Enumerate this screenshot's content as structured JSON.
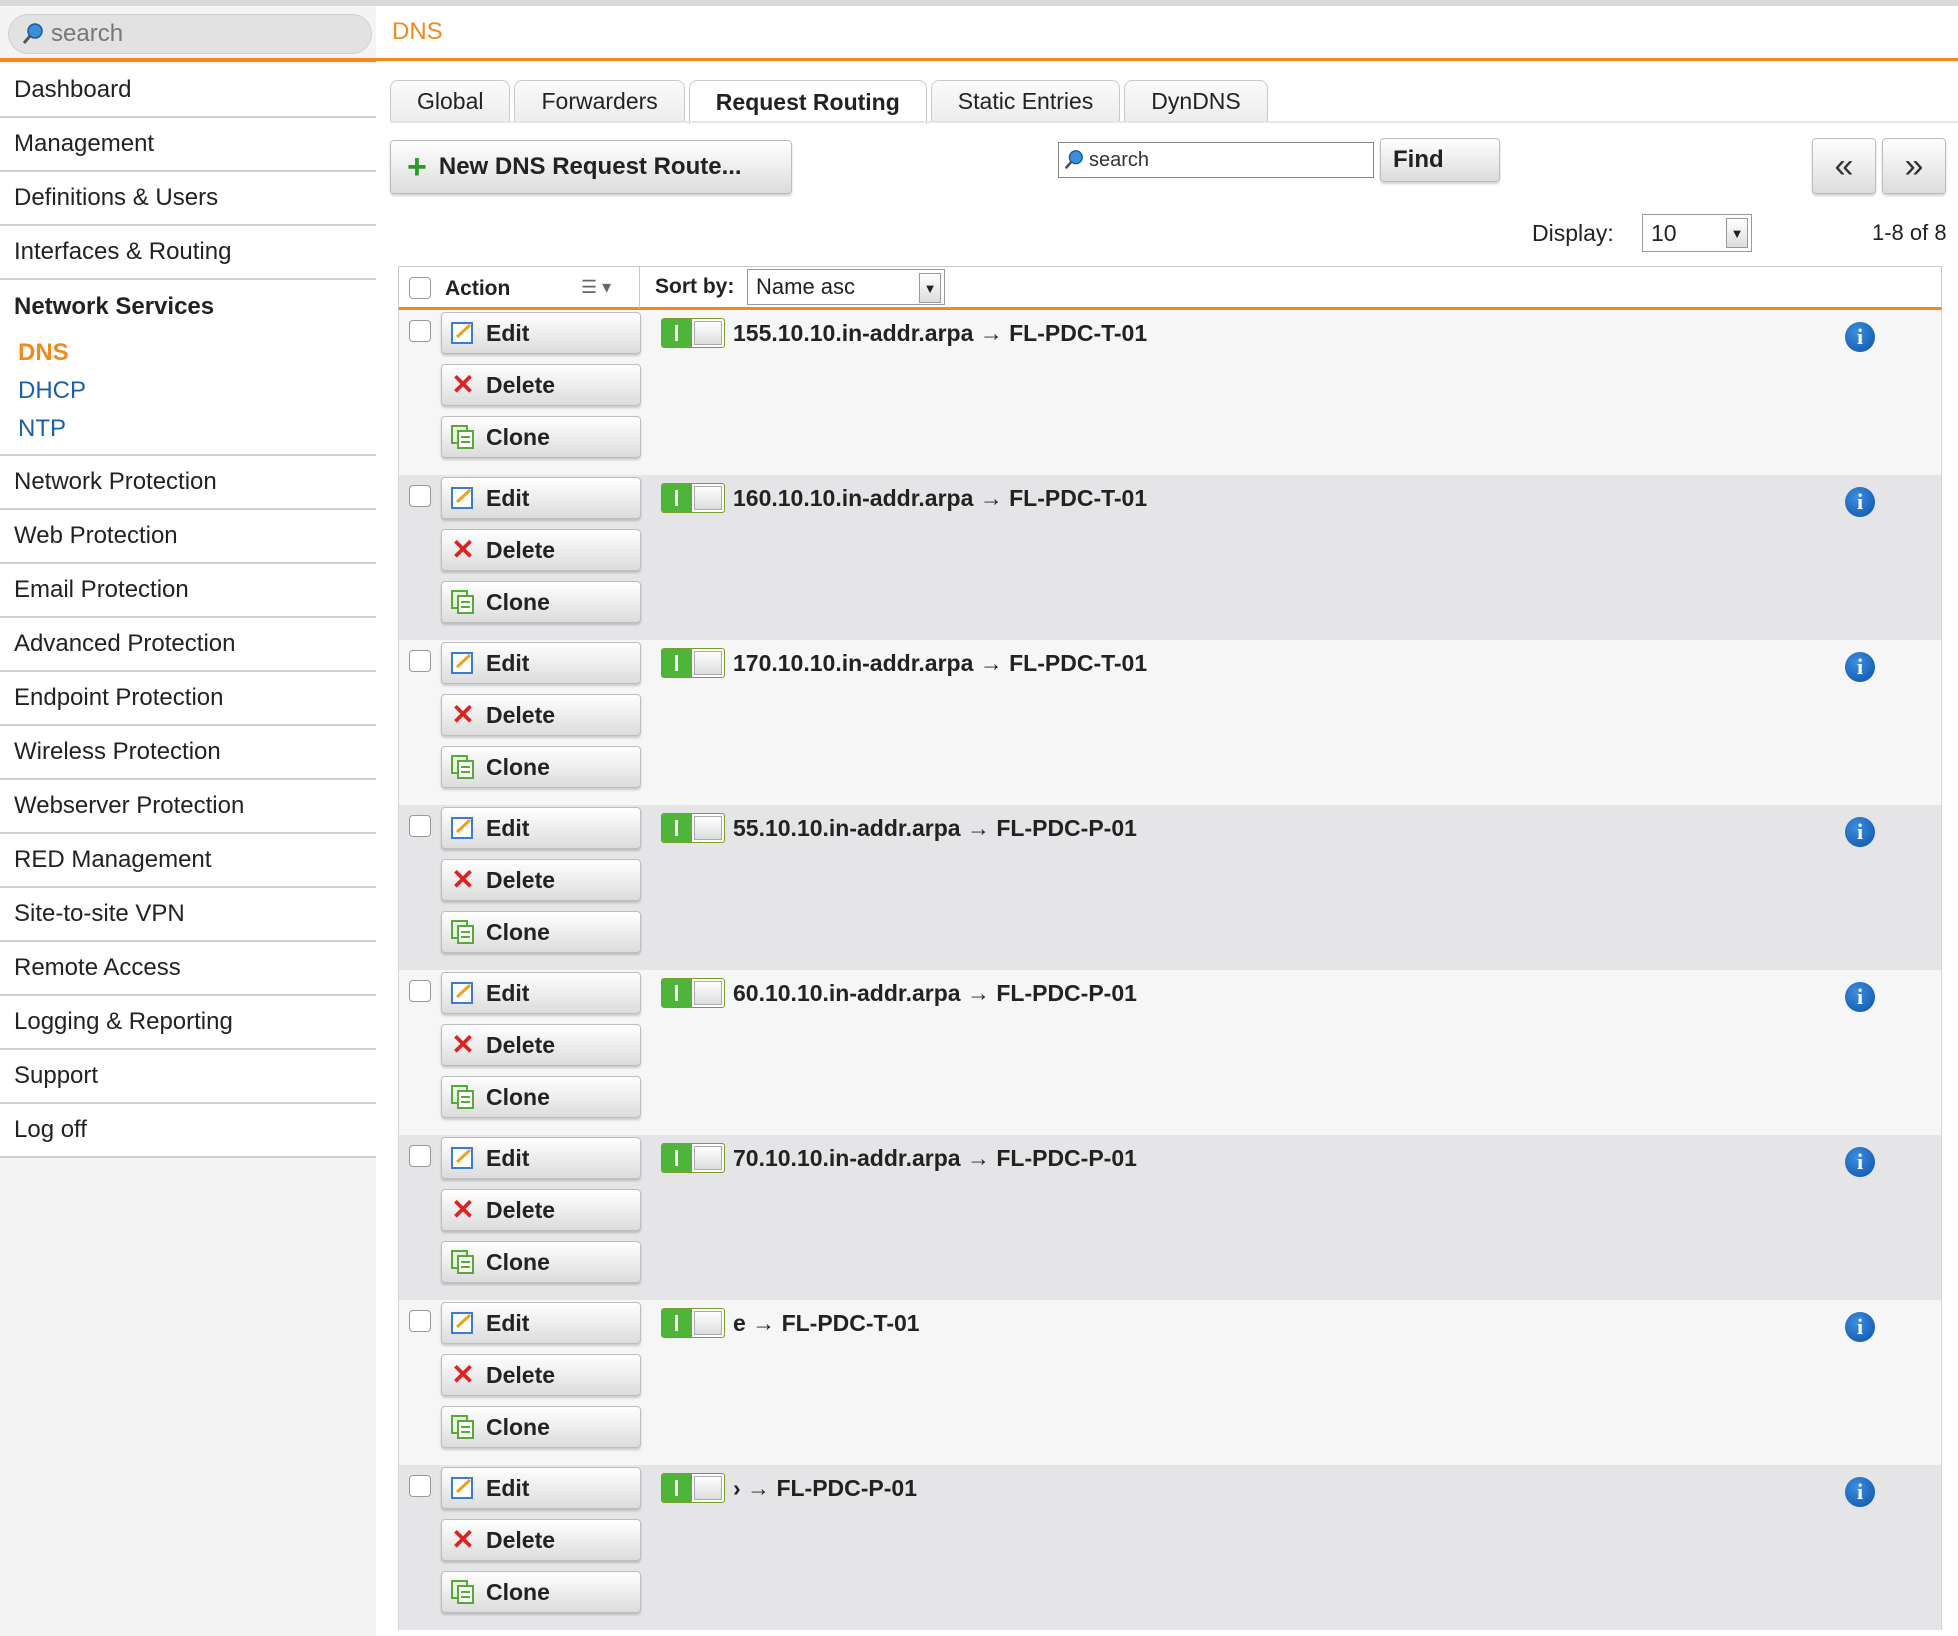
{
  "sidebar": {
    "search_placeholder": "search",
    "items_top": [
      "Dashboard",
      "Management",
      "Definitions & Users",
      "Interfaces & Routing"
    ],
    "section": {
      "label": "Network Services",
      "subitems": [
        {
          "label": "DNS",
          "active": true
        },
        {
          "label": "DHCP",
          "active": false
        },
        {
          "label": "NTP",
          "active": false
        }
      ]
    },
    "items_bottom": [
      "Network Protection",
      "Web Protection",
      "Email Protection",
      "Advanced Protection",
      "Endpoint Protection",
      "Wireless Protection",
      "Webserver Protection",
      "RED Management",
      "Site-to-site VPN",
      "Remote Access",
      "Logging & Reporting",
      "Support",
      "Log off"
    ]
  },
  "header": {
    "title": "DNS"
  },
  "tabs": [
    {
      "label": "Global",
      "active": false
    },
    {
      "label": "Forwarders",
      "active": false
    },
    {
      "label": "Request Routing",
      "active": true
    },
    {
      "label": "Static Entries",
      "active": false
    },
    {
      "label": "DynDNS",
      "active": false
    }
  ],
  "toolbar": {
    "new_button_label": "New DNS Request Route...",
    "find_placeholder": "search",
    "find_button_label": "Find",
    "prev_label": "«",
    "next_label": "»",
    "display_label": "Display:",
    "display_value": "10",
    "range_label": "1-8 of 8"
  },
  "table": {
    "action_header": "Action",
    "sort_label": "Sort by:",
    "sort_value": "Name asc",
    "edit_label": "Edit",
    "delete_label": "Delete",
    "clone_label": "Clone",
    "rows": [
      {
        "name": "155.10.10.in-addr.arpa → FL-PDC-T-01",
        "enabled": true
      },
      {
        "name": "160.10.10.in-addr.arpa → FL-PDC-T-01",
        "enabled": true
      },
      {
        "name": "170.10.10.in-addr.arpa → FL-PDC-T-01",
        "enabled": true
      },
      {
        "name": "55.10.10.in-addr.arpa → FL-PDC-P-01",
        "enabled": true
      },
      {
        "name": "60.10.10.in-addr.arpa → FL-PDC-P-01",
        "enabled": true
      },
      {
        "name": "70.10.10.in-addr.arpa → FL-PDC-P-01",
        "enabled": true
      },
      {
        "name": "e → FL-PDC-T-01",
        "enabled": true,
        "redacted": true
      },
      {
        "name": "› → FL-PDC-P-01",
        "enabled": true,
        "redacted": true
      }
    ]
  },
  "colors": {
    "accent": "#f08a1d",
    "link": "#1d5fa6",
    "toggle_on": "#4fb43a",
    "delete_red": "#dd2222",
    "info_blue": "#0a4fa8"
  }
}
